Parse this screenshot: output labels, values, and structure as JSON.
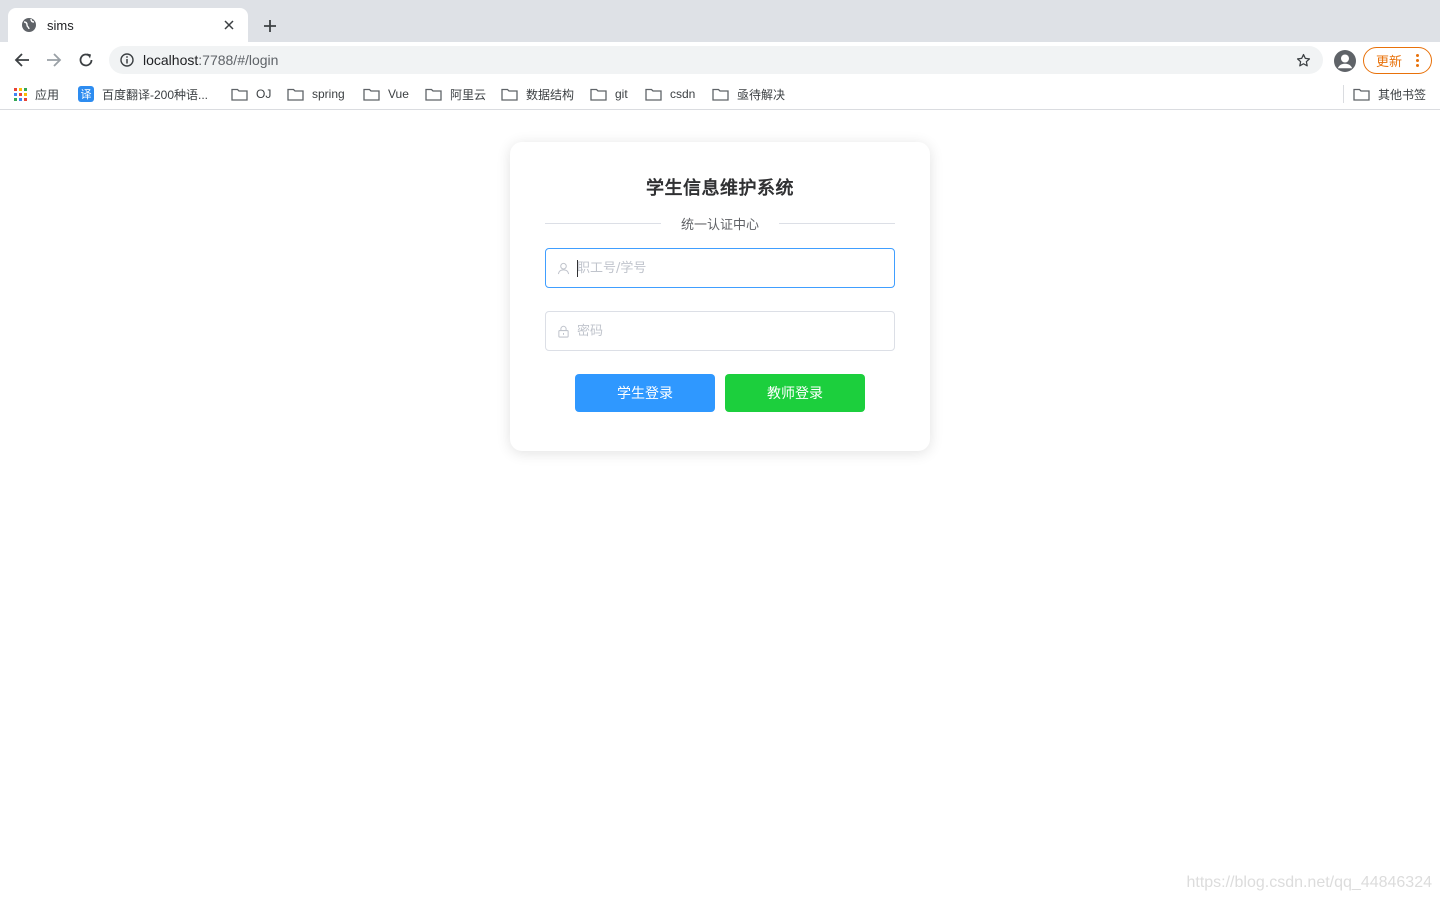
{
  "browser": {
    "tab_title": "sims",
    "url_host": "localhost",
    "url_rest": ":7788/#/login",
    "update_label": "更新"
  },
  "bookmarks": {
    "apps_label": "应用",
    "items": [
      {
        "label": "百度翻译-200种语..."
      },
      {
        "label": "OJ"
      },
      {
        "label": "spring"
      },
      {
        "label": "Vue"
      },
      {
        "label": "阿里云"
      },
      {
        "label": "数据结构"
      },
      {
        "label": "git"
      },
      {
        "label": "csdn"
      },
      {
        "label": "亟待解决"
      }
    ],
    "other_label": "其他书签",
    "translate_icon_text": "译"
  },
  "login": {
    "title": "学生信息维护系统",
    "subtitle": "统一认证中心",
    "username_placeholder": "职工号/学号",
    "password_placeholder": "密码",
    "student_button": "学生登录",
    "teacher_button": "教师登录"
  },
  "watermark": "https://blog.csdn.net/qq_44846324",
  "colors": {
    "primary": "#2f98ff",
    "success": "#1ccf3d",
    "focus_border": "#409eff",
    "update_orange": "#e8710a"
  }
}
